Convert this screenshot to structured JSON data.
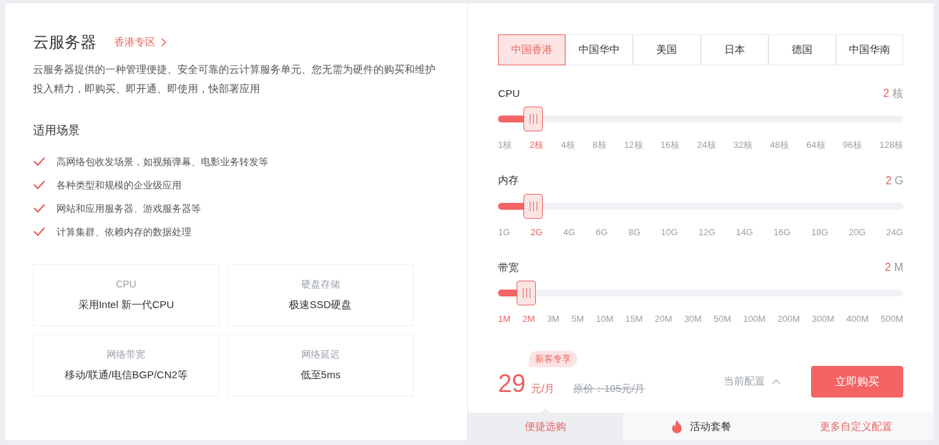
{
  "left": {
    "title": "云服务器",
    "region_link": "香港专区",
    "description": "云服务器提供的一种管理便捷、安全可靠的云计算服务单元、您无需为硬件的购买和维护投入精力，即购买、即开通、即使用，快部署应用",
    "scenarios_title": "适用场景",
    "scenarios": [
      "高网络包收发场景，如视频弹幕、电影业务转发等",
      "各种类型和规模的企业级应用",
      "网站和应用服务器、游戏服务器等",
      "计算集群、依赖内存的数据处理"
    ],
    "features": [
      {
        "label": "CPU",
        "value": "采用Intel 新一代CPU"
      },
      {
        "label": "硬盘存储",
        "value": "极速SSD硬盘"
      },
      {
        "label": "网络带宽",
        "value": "移动/联通/电信BGP/CN2等"
      },
      {
        "label": "网络延迟",
        "value": "低至5ms"
      }
    ]
  },
  "regions": [
    {
      "label": "中国香港",
      "selected": true
    },
    {
      "label": "中国华中",
      "selected": false
    },
    {
      "label": "美国",
      "selected": false
    },
    {
      "label": "日本",
      "selected": false
    },
    {
      "label": "德国",
      "selected": false
    },
    {
      "label": "中国华南",
      "selected": false
    }
  ],
  "sliders": [
    {
      "label": "CPU",
      "value": "2",
      "unit": "核",
      "level": 0.087,
      "ticks": [
        {
          "label": "1核",
          "selected": false
        },
        {
          "label": "2核",
          "selected": true
        },
        {
          "label": "4核",
          "selected": false
        },
        {
          "label": "8核",
          "selected": false
        },
        {
          "label": "12核",
          "selected": false
        },
        {
          "label": "16核",
          "selected": false
        },
        {
          "label": "24核",
          "selected": false
        },
        {
          "label": "32核",
          "selected": false
        },
        {
          "label": "48核",
          "selected": false
        },
        {
          "label": "64核",
          "selected": false
        },
        {
          "label": "96核",
          "selected": false
        },
        {
          "label": "128核",
          "selected": false
        }
      ]
    },
    {
      "label": "内存",
      "value": "2",
      "unit": "G",
      "level": 0.087,
      "ticks": [
        {
          "label": "1G",
          "selected": false
        },
        {
          "label": "2G",
          "selected": true
        },
        {
          "label": "4G",
          "selected": false
        },
        {
          "label": "6G",
          "selected": false
        },
        {
          "label": "8G",
          "selected": false
        },
        {
          "label": "10G",
          "selected": false
        },
        {
          "label": "12G",
          "selected": false
        },
        {
          "label": "14G",
          "selected": false
        },
        {
          "label": "16G",
          "selected": false
        },
        {
          "label": "18G",
          "selected": false
        },
        {
          "label": "20G",
          "selected": false
        },
        {
          "label": "24G",
          "selected": false
        }
      ]
    },
    {
      "label": "带宽",
      "value": "2",
      "unit": "M",
      "level": 0.07,
      "ticks": [
        {
          "label": "1M",
          "selected": true
        },
        {
          "label": "2M",
          "selected": true
        },
        {
          "label": "3M",
          "selected": false
        },
        {
          "label": "5M",
          "selected": false
        },
        {
          "label": "10M",
          "selected": false
        },
        {
          "label": "15M",
          "selected": false
        },
        {
          "label": "20M",
          "selected": false
        },
        {
          "label": "30M",
          "selected": false
        },
        {
          "label": "50M",
          "selected": false
        },
        {
          "label": "100M",
          "selected": false
        },
        {
          "label": "200M",
          "selected": false
        },
        {
          "label": "300M",
          "selected": false
        },
        {
          "label": "400M",
          "selected": false
        },
        {
          "label": "500M",
          "selected": false
        }
      ]
    }
  ],
  "price": {
    "badge": "新客专享",
    "amount": "29",
    "unit": "元/月",
    "original": "原价：105元/月",
    "config_toggle": "当前配置",
    "expanded": true,
    "buy_button": "立即购买"
  },
  "bottom_tabs": [
    {
      "label": "便捷选购",
      "selected": true,
      "accent": true,
      "kind": "plain"
    },
    {
      "label": "活动套餐",
      "selected": false,
      "accent": false,
      "kind": "fire"
    },
    {
      "label": "更多自定义配置",
      "selected": false,
      "accent": true,
      "kind": "plain"
    }
  ]
}
